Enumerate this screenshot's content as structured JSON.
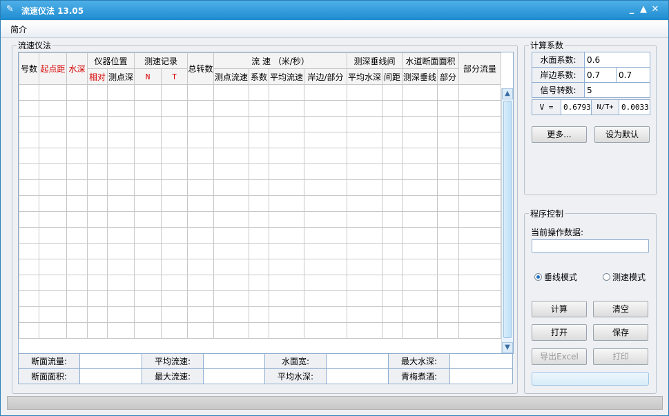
{
  "window": {
    "title": "流速仪法 13.05",
    "controls": [
      "_",
      "▲",
      "✕"
    ]
  },
  "menu": {
    "items": [
      "简介"
    ]
  },
  "flow_group": {
    "legend": "流速仪法",
    "header_row1": {
      "hao": "号数",
      "qidian": "起点距",
      "shui": "水深",
      "yiqi": "仪器位置",
      "cesu": "测速记录",
      "zongzhuan": "总转数",
      "liusu": "流 速 （米/秒）",
      "cesheng": "测深垂线间",
      "duanmian": "水道断面面积",
      "bufen_liuliang": "部分流量"
    },
    "header_row2": [
      "相对",
      "测点深",
      "N",
      "T",
      "测点流速",
      "系数",
      "平均流速",
      "岸边/部分",
      "平均水深",
      "间距",
      "测深垂线",
      "部分"
    ],
    "empty_rows": 16,
    "summary": [
      [
        "断面流量:",
        "",
        "平均流速:",
        "",
        "水面宽:",
        "",
        "最大水深:",
        ""
      ],
      [
        "断面面积:",
        "",
        "最大流速:",
        "",
        "平均水深:",
        "",
        "青梅煮酒:",
        ""
      ]
    ]
  },
  "coef_group": {
    "legend": "计算系数",
    "surface_label": "水面系数:",
    "surface_value": "0.6",
    "bank_label": "岸边系数:",
    "bank_value1": "0.7",
    "bank_value2": "0.7",
    "signal_label": "信号转数:",
    "signal_value": "5",
    "v_label": "V =",
    "v_value": "0.6793",
    "nt_label": "N/T+",
    "nt_value": "0.0033",
    "more_button": "更多...",
    "default_button": "设为默认"
  },
  "control_group": {
    "legend": "程序控制",
    "current_label": "当前操作数据:",
    "current_value": "",
    "mode_vertical": "垂线模式",
    "mode_speed": "测速模式",
    "mode_selected": "vertical",
    "calc_button": "计算",
    "clear_button": "清空",
    "open_button": "打开",
    "save_button": "保存",
    "export_button": "导出Excel",
    "print_button": "打印"
  },
  "colors": {
    "title_bar": "#1e8bd0",
    "accent_red": "#d60000",
    "border_blue": "#8faed0"
  }
}
